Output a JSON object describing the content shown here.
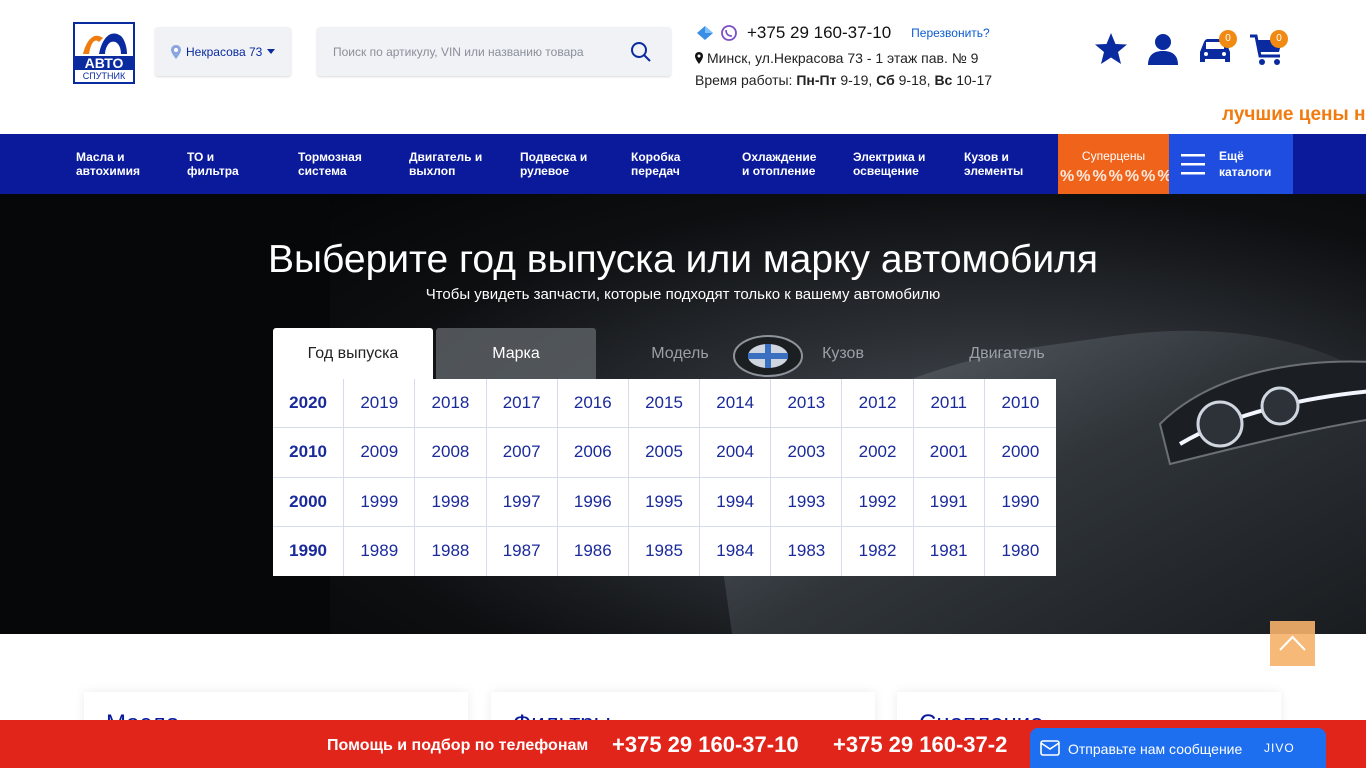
{
  "header": {
    "logo": {
      "line1": "АВТО",
      "line2": "СПУТНИК"
    },
    "location": {
      "label": "Некрасова 73"
    },
    "search": {
      "placeholder": "Поиск по артикулу, VIN или названию товара"
    },
    "contacts": {
      "phone": "+375 29 160-37-10",
      "callback": "Перезвонить?",
      "address": "Минск, ул.Некрасова 73 - 1 этаж пав. № 9",
      "hours_label": "Время работы: ",
      "hours_d1": "Пн-Пт",
      "hours_t1": " 9-19, ",
      "hours_d2": "Сб",
      "hours_t2": " 9-18, ",
      "hours_d3": "Вс",
      "hours_t3": " 10-17"
    },
    "garage_count": "0",
    "cart_count": "0",
    "promo": "лучшие цены н"
  },
  "nav": {
    "items": [
      {
        "l1": "Масла и",
        "l2": "автохимия"
      },
      {
        "l1": "ТО и",
        "l2": "фильтра"
      },
      {
        "l1": "Тормозная",
        "l2": "система"
      },
      {
        "l1": "Двигатель и",
        "l2": "выхлоп"
      },
      {
        "l1": "Подвеска и",
        "l2": "рулевое"
      },
      {
        "l1": "Коробка",
        "l2": "передач"
      },
      {
        "l1": "Охлаждение",
        "l2": "и отопление"
      },
      {
        "l1": "Электрика и",
        "l2": "освещение"
      },
      {
        "l1": "Кузов и",
        "l2": "элементы"
      }
    ],
    "super": "Суперцены",
    "super_pct": "%%%%%%%",
    "more": {
      "l1": "Ещё",
      "l2": "каталоги"
    }
  },
  "hero": {
    "title": "Выберите год выпуска или марку автомобиля",
    "subtitle": "Чтобы увидеть запчасти, которые подходят только к вашему автомобилю",
    "tabs": [
      "Год выпуска",
      "Марка",
      "Модель",
      "Кузов",
      "Двигатель"
    ],
    "years": [
      [
        "2020",
        "2019",
        "2018",
        "2017",
        "2016",
        "2015",
        "2014",
        "2013",
        "2012",
        "2011",
        "2010"
      ],
      [
        "2010",
        "2009",
        "2008",
        "2007",
        "2006",
        "2005",
        "2004",
        "2003",
        "2002",
        "2001",
        "2000"
      ],
      [
        "2000",
        "1999",
        "1998",
        "1997",
        "1996",
        "1995",
        "1994",
        "1993",
        "1992",
        "1991",
        "1990"
      ],
      [
        "1990",
        "1989",
        "1988",
        "1987",
        "1986",
        "1985",
        "1984",
        "1983",
        "1982",
        "1981",
        "1980"
      ]
    ]
  },
  "cards": [
    "Масло",
    "Фильтры",
    "Сцепление"
  ],
  "bottom": {
    "help": "Помощь и подбор по телефонам",
    "phone1": "+375 29 160-37-10",
    "phone2": "+375 29 160-37-2",
    "chat": "Отправьте нам сообщение",
    "jivo": "JIVO"
  },
  "colors": {
    "brand": "#0a1a9b",
    "accent": "#f0631a",
    "bar": "#e1251b",
    "chat": "#1e6ff0"
  }
}
